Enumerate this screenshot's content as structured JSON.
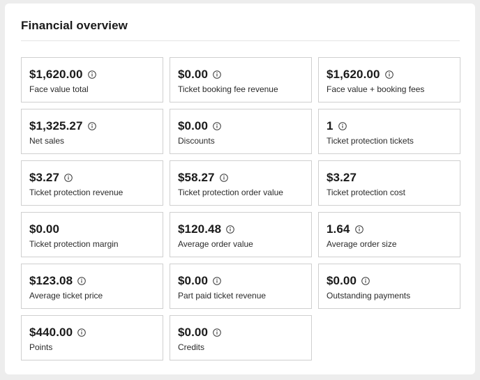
{
  "panel": {
    "title": "Financial overview"
  },
  "metrics": [
    {
      "value": "$1,620.00",
      "label": "Face value total",
      "info": true
    },
    {
      "value": "$0.00",
      "label": "Ticket booking fee revenue",
      "info": true
    },
    {
      "value": "$1,620.00",
      "label": "Face value + booking fees",
      "info": true
    },
    {
      "value": "$1,325.27",
      "label": "Net sales",
      "info": true
    },
    {
      "value": "$0.00",
      "label": "Discounts",
      "info": true
    },
    {
      "value": "1",
      "label": "Ticket protection tickets",
      "info": true
    },
    {
      "value": "$3.27",
      "label": "Ticket protection revenue",
      "info": true
    },
    {
      "value": "$58.27",
      "label": "Ticket protection order value",
      "info": true
    },
    {
      "value": "$3.27",
      "label": "Ticket protection cost",
      "info": false
    },
    {
      "value": "$0.00",
      "label": "Ticket protection margin",
      "info": false
    },
    {
      "value": "$120.48",
      "label": "Average order value",
      "info": true
    },
    {
      "value": "1.64",
      "label": "Average order size",
      "info": true
    },
    {
      "value": "$123.08",
      "label": "Average ticket price",
      "info": true
    },
    {
      "value": "$0.00",
      "label": "Part paid ticket revenue",
      "info": true
    },
    {
      "value": "$0.00",
      "label": "Outstanding payments",
      "info": true
    },
    {
      "value": "$440.00",
      "label": "Points",
      "info": true
    },
    {
      "value": "$0.00",
      "label": "Credits",
      "info": true
    }
  ],
  "colors": {
    "page_background": "#ededed",
    "panel_background": "#ffffff",
    "card_border": "#cfcfcf",
    "text": "#1a1a1a",
    "icon": "#3a3a3a"
  },
  "icons": {
    "info": "info-circle-icon"
  }
}
